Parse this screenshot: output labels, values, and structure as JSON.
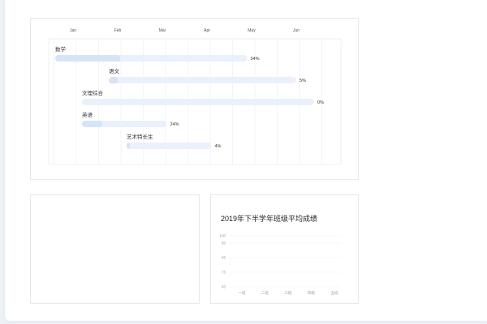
{
  "gantt": {
    "months": [
      "Jan",
      "Feb",
      "Mar",
      "Apr",
      "May",
      "Jun"
    ],
    "tasks": [
      {
        "name": "数学",
        "start": 0.0,
        "end": 4.3,
        "progress": 0.34,
        "percent_label": "34%"
      },
      {
        "name": "语文",
        "start": 1.2,
        "end": 5.4,
        "progress": 0.05,
        "percent_label": "5%"
      },
      {
        "name": "文理综合",
        "start": 0.6,
        "end": 5.8,
        "progress": 0.0,
        "percent_label": "0%"
      },
      {
        "name": "英语",
        "start": 0.6,
        "end": 2.5,
        "progress": 0.24,
        "percent_label": "24%"
      },
      {
        "name": "艺术特长生",
        "start": 1.6,
        "end": 3.5,
        "progress": 0.04,
        "percent_label": "4%"
      }
    ],
    "colors": {
      "bar_bg": "#eaf1fc",
      "bar_fill": "#d6e4f7",
      "grid": "#e6e8ee"
    }
  },
  "score_chart": {
    "title": "2019年下半学年班级平均成绩"
  },
  "chart_data": {
    "type": "line",
    "title": "2019年下半学年班级平均成绩",
    "categories": [
      "一班",
      "二班",
      "三班",
      "四班",
      "五班"
    ],
    "yticks": [
      65,
      75,
      85,
      95,
      100
    ],
    "ylim": [
      65,
      100
    ],
    "series": [],
    "grid": true
  }
}
